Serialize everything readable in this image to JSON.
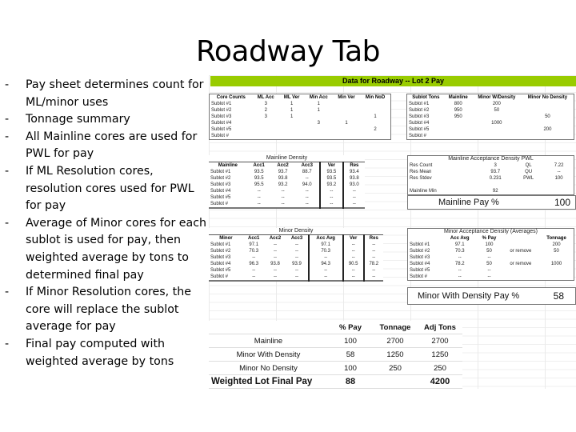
{
  "slide": {
    "title": "Roadway Tab",
    "bullets": [
      "Pay sheet determines count for ML/minor uses",
      "Tonnage summary",
      "All Mainline cores are used for PWL for pay",
      "If ML Resolution cores, resolution cores used for PWL for pay",
      "Average of Minor cores for each sublot is used for pay, then weighted average by tons to determined final pay",
      "If Minor Resolution cores, the core will replace the sublot average for pay",
      "Final pay computed with weighted average by tons"
    ],
    "bullet_marker": "-"
  },
  "sheet": {
    "banner": "Data for Roadway -- Lot 2 Pay",
    "banner_color": "#99cc00",
    "core_counts": {
      "headers": [
        "Core Counts",
        "ML Acc",
        "ML Ver",
        "Min Acc",
        "Min Ver",
        "Min NoD"
      ],
      "rows": [
        [
          "Sublot #1",
          "3",
          "1",
          "1",
          "",
          ""
        ],
        [
          "Sublot #2",
          "2",
          "1",
          "1",
          "",
          ""
        ],
        [
          "Sublot #3",
          "3",
          "1",
          "",
          "",
          "1"
        ],
        [
          "Sublot #4",
          "",
          "",
          "3",
          "1",
          ""
        ],
        [
          "Sublot #5",
          "",
          "",
          "",
          "",
          "2"
        ],
        [
          "Sublot #",
          "",
          "",
          "",
          "",
          ""
        ]
      ]
    },
    "sublot_tons": {
      "headers": [
        "Sublot Tons",
        "Mainline",
        "Minor W/Density",
        "Minor No Density"
      ],
      "rows": [
        [
          "Sublot #1",
          "800",
          "200",
          ""
        ],
        [
          "Sublot #2",
          "950",
          "50",
          ""
        ],
        [
          "Sublot #3",
          "950",
          "",
          "50"
        ],
        [
          "Sublot #4",
          "",
          "1000",
          ""
        ],
        [
          "Sublot #5",
          "",
          "",
          "200"
        ],
        [
          "Sublot #",
          "",
          "",
          ""
        ]
      ]
    },
    "mainline_density": {
      "caption": "Mainline Density",
      "headers": [
        "Mainline",
        "Acc1",
        "Acc2",
        "Acc3",
        "Ver",
        "Res"
      ],
      "rows": [
        [
          "Sublot #1",
          "93.5",
          "93.7",
          "88.7",
          "93.5",
          "93.4"
        ],
        [
          "Sublot #2",
          "93.5",
          "93.8",
          "--",
          "93.5",
          "93.8"
        ],
        [
          "Sublot #3",
          "95.5",
          "93.2",
          "94.0",
          "93.2",
          "93.0"
        ],
        [
          "Sublot #4",
          "--",
          "--",
          "--",
          "--",
          "--"
        ],
        [
          "Sublot #5",
          "--",
          "--",
          "--",
          "--",
          "--"
        ],
        [
          "Sublot #",
          "--",
          "--",
          "--",
          "--",
          "--"
        ]
      ]
    },
    "mainline_pwl": {
      "caption": "Mainline Acceptance Density PWL",
      "rows": [
        [
          "Res Count",
          "3",
          "QL",
          "7.22"
        ],
        [
          "Res Mean",
          "93.7",
          "QU",
          "--"
        ],
        [
          "Res Stdev",
          "0.231",
          "PWL",
          "100"
        ],
        [
          "",
          "",
          "",
          ""
        ],
        [
          "Mainline Min",
          "92",
          "",
          ""
        ]
      ],
      "pay_label": "Mainline Pay %",
      "pay_value": "100"
    },
    "minor_density": {
      "caption": "Minor Density",
      "headers": [
        "Minor",
        "Acc1",
        "Acc2",
        "Acc3",
        "Acc Avg",
        "Ver",
        "Res"
      ],
      "rows": [
        [
          "Sublot #1",
          "97.1",
          "--",
          "--",
          "97.1",
          "--",
          "--"
        ],
        [
          "Sublot #2",
          "70.3",
          "--",
          "--",
          "70.3",
          "--",
          "--"
        ],
        [
          "Sublot #3",
          "--",
          "--",
          "--",
          "--",
          "--",
          "--"
        ],
        [
          "Sublot #4",
          "96.3",
          "93.8",
          "93.9",
          "94.3",
          "90.5",
          "78.2"
        ],
        [
          "Sublot #5",
          "--",
          "--",
          "--",
          "--",
          "--",
          "--"
        ],
        [
          "Sublot #",
          "--",
          "--",
          "--",
          "--",
          "--",
          "--"
        ]
      ]
    },
    "minor_acceptance": {
      "caption": "Minor Acceptance Density (Averages)",
      "headers": [
        "",
        "Acc Avg",
        "% Pay",
        "",
        "Tonnage"
      ],
      "rows": [
        [
          "Sublot #1",
          "97.1",
          "100",
          "",
          "200"
        ],
        [
          "Sublot #2",
          "70.3",
          "50",
          "or remove",
          "50"
        ],
        [
          "Sublot #3",
          "--",
          "--",
          "",
          ""
        ],
        [
          "Sublot #4",
          "78.2",
          "50",
          "or remove",
          "1000"
        ],
        [
          "Sublot #5",
          "--",
          "--",
          "",
          ""
        ],
        [
          "Sublot #",
          "--",
          "--",
          "",
          ""
        ]
      ],
      "pay_label": "Minor With Density Pay %",
      "pay_value": "58"
    },
    "summary": {
      "headers": [
        "",
        "% Pay",
        "Tonnage",
        "Adj Tons"
      ],
      "rows": [
        [
          "Mainline",
          "100",
          "2700",
          "2700"
        ],
        [
          "Minor With Density",
          "58",
          "1250",
          "1250"
        ],
        [
          "Minor No Density",
          "100",
          "250",
          "250"
        ]
      ],
      "final": [
        "Weighted Lot Final Pay",
        "88",
        "",
        "4200"
      ]
    }
  }
}
